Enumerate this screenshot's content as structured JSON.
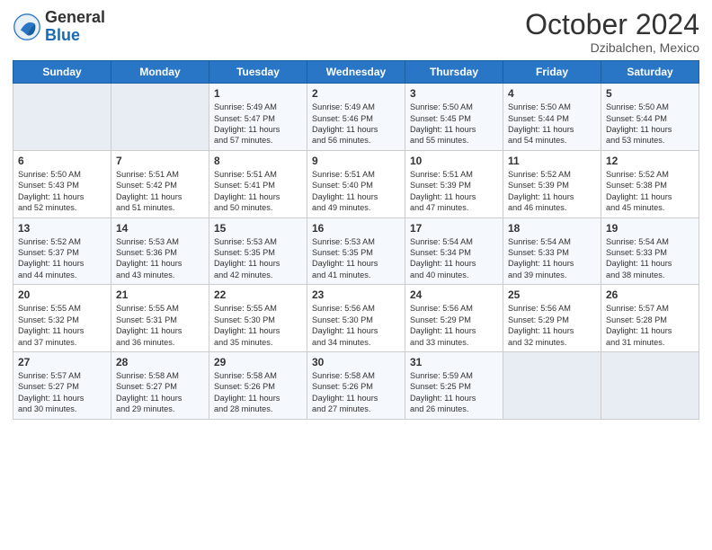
{
  "logo": {
    "general": "General",
    "blue": "Blue"
  },
  "header": {
    "month": "October 2024",
    "location": "Dzibalchen, Mexico"
  },
  "weekdays": [
    "Sunday",
    "Monday",
    "Tuesday",
    "Wednesday",
    "Thursday",
    "Friday",
    "Saturday"
  ],
  "weeks": [
    [
      {
        "day": "",
        "detail": ""
      },
      {
        "day": "",
        "detail": ""
      },
      {
        "day": "1",
        "detail": "Sunrise: 5:49 AM\nSunset: 5:47 PM\nDaylight: 11 hours\nand 57 minutes."
      },
      {
        "day": "2",
        "detail": "Sunrise: 5:49 AM\nSunset: 5:46 PM\nDaylight: 11 hours\nand 56 minutes."
      },
      {
        "day": "3",
        "detail": "Sunrise: 5:50 AM\nSunset: 5:45 PM\nDaylight: 11 hours\nand 55 minutes."
      },
      {
        "day": "4",
        "detail": "Sunrise: 5:50 AM\nSunset: 5:44 PM\nDaylight: 11 hours\nand 54 minutes."
      },
      {
        "day": "5",
        "detail": "Sunrise: 5:50 AM\nSunset: 5:44 PM\nDaylight: 11 hours\nand 53 minutes."
      }
    ],
    [
      {
        "day": "6",
        "detail": "Sunrise: 5:50 AM\nSunset: 5:43 PM\nDaylight: 11 hours\nand 52 minutes."
      },
      {
        "day": "7",
        "detail": "Sunrise: 5:51 AM\nSunset: 5:42 PM\nDaylight: 11 hours\nand 51 minutes."
      },
      {
        "day": "8",
        "detail": "Sunrise: 5:51 AM\nSunset: 5:41 PM\nDaylight: 11 hours\nand 50 minutes."
      },
      {
        "day": "9",
        "detail": "Sunrise: 5:51 AM\nSunset: 5:40 PM\nDaylight: 11 hours\nand 49 minutes."
      },
      {
        "day": "10",
        "detail": "Sunrise: 5:51 AM\nSunset: 5:39 PM\nDaylight: 11 hours\nand 47 minutes."
      },
      {
        "day": "11",
        "detail": "Sunrise: 5:52 AM\nSunset: 5:39 PM\nDaylight: 11 hours\nand 46 minutes."
      },
      {
        "day": "12",
        "detail": "Sunrise: 5:52 AM\nSunset: 5:38 PM\nDaylight: 11 hours\nand 45 minutes."
      }
    ],
    [
      {
        "day": "13",
        "detail": "Sunrise: 5:52 AM\nSunset: 5:37 PM\nDaylight: 11 hours\nand 44 minutes."
      },
      {
        "day": "14",
        "detail": "Sunrise: 5:53 AM\nSunset: 5:36 PM\nDaylight: 11 hours\nand 43 minutes."
      },
      {
        "day": "15",
        "detail": "Sunrise: 5:53 AM\nSunset: 5:35 PM\nDaylight: 11 hours\nand 42 minutes."
      },
      {
        "day": "16",
        "detail": "Sunrise: 5:53 AM\nSunset: 5:35 PM\nDaylight: 11 hours\nand 41 minutes."
      },
      {
        "day": "17",
        "detail": "Sunrise: 5:54 AM\nSunset: 5:34 PM\nDaylight: 11 hours\nand 40 minutes."
      },
      {
        "day": "18",
        "detail": "Sunrise: 5:54 AM\nSunset: 5:33 PM\nDaylight: 11 hours\nand 39 minutes."
      },
      {
        "day": "19",
        "detail": "Sunrise: 5:54 AM\nSunset: 5:33 PM\nDaylight: 11 hours\nand 38 minutes."
      }
    ],
    [
      {
        "day": "20",
        "detail": "Sunrise: 5:55 AM\nSunset: 5:32 PM\nDaylight: 11 hours\nand 37 minutes."
      },
      {
        "day": "21",
        "detail": "Sunrise: 5:55 AM\nSunset: 5:31 PM\nDaylight: 11 hours\nand 36 minutes."
      },
      {
        "day": "22",
        "detail": "Sunrise: 5:55 AM\nSunset: 5:30 PM\nDaylight: 11 hours\nand 35 minutes."
      },
      {
        "day": "23",
        "detail": "Sunrise: 5:56 AM\nSunset: 5:30 PM\nDaylight: 11 hours\nand 34 minutes."
      },
      {
        "day": "24",
        "detail": "Sunrise: 5:56 AM\nSunset: 5:29 PM\nDaylight: 11 hours\nand 33 minutes."
      },
      {
        "day": "25",
        "detail": "Sunrise: 5:56 AM\nSunset: 5:29 PM\nDaylight: 11 hours\nand 32 minutes."
      },
      {
        "day": "26",
        "detail": "Sunrise: 5:57 AM\nSunset: 5:28 PM\nDaylight: 11 hours\nand 31 minutes."
      }
    ],
    [
      {
        "day": "27",
        "detail": "Sunrise: 5:57 AM\nSunset: 5:27 PM\nDaylight: 11 hours\nand 30 minutes."
      },
      {
        "day": "28",
        "detail": "Sunrise: 5:58 AM\nSunset: 5:27 PM\nDaylight: 11 hours\nand 29 minutes."
      },
      {
        "day": "29",
        "detail": "Sunrise: 5:58 AM\nSunset: 5:26 PM\nDaylight: 11 hours\nand 28 minutes."
      },
      {
        "day": "30",
        "detail": "Sunrise: 5:58 AM\nSunset: 5:26 PM\nDaylight: 11 hours\nand 27 minutes."
      },
      {
        "day": "31",
        "detail": "Sunrise: 5:59 AM\nSunset: 5:25 PM\nDaylight: 11 hours\nand 26 minutes."
      },
      {
        "day": "",
        "detail": ""
      },
      {
        "day": "",
        "detail": ""
      }
    ]
  ]
}
